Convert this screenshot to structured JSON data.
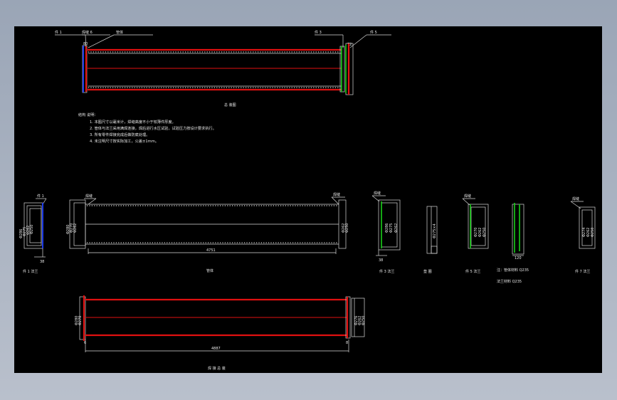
{
  "notes": {
    "title": "结构 说明：",
    "lines": [
      "1. 本图尺寸以毫米计，焊缝高度不小于较薄件厚度。",
      "2. 管体与法兰采用满焊连接，焊后进行水压试验，试验压力按设计要求执行。",
      "3. 所有零件焊接完成后做防腐处理。",
      "4. 未注明尺寸按实际加工，公差±1mm。"
    ]
  },
  "views": {
    "top_caption": "总 装图",
    "left_dims": [
      "Φ286",
      "Φ275",
      "Φ262",
      "Φ250"
    ],
    "left_bottom": "38",
    "left_caption": "件 1 法兰",
    "tube_dims": [
      "Φ280",
      "Φ270",
      "Φ262"
    ],
    "tube_right_dims": [
      "Φ262",
      "Φ250"
    ],
    "tube_length": "4751",
    "tube_caption": "管体",
    "part3_dims": [
      "Φ286",
      "Φ275",
      "Φ262"
    ],
    "part3_bottom": "38",
    "part3_caption": "件 3 法兰",
    "part4_dim": "Φ275×4",
    "part4_caption": "垫 圈",
    "part5_dims": [
      "Φ270",
      "Φ262",
      "Φ250"
    ],
    "part5_caption": "件 5 法兰",
    "part6_bottom": "120",
    "legend_lines": [
      "注：管体材料 Q235",
      "法兰材料 Q235"
    ],
    "part7_dims": [
      "Φ274",
      "Φ262",
      "Φ250"
    ],
    "part7_caption": "件 7 法兰",
    "bottom_dims": [
      "Φ280",
      "Φ270"
    ],
    "bottom_right_dims": [
      "Φ276",
      "Φ262",
      "Φ250"
    ],
    "bottom_length": "4887",
    "bottom_left_mark": "6",
    "bottom_right_mark": "8",
    "bottom_caption": "焊 接 总 装"
  },
  "callouts": {
    "top_left_a": "件 1",
    "top_left_b": "焊缝 6",
    "top_left_c": "管体",
    "top_left_num": "80",
    "top_right_a": "件 3",
    "top_right_b": "件 5",
    "top_right_num": "72",
    "mid_left": "件 1",
    "mid_tube_left": "焊缝",
    "mid_tube_right": "焊缝",
    "mid_p3": "焊缝",
    "mid_p5": "焊缝",
    "mid_p7": "焊缝"
  },
  "colors": {
    "background": "#000000",
    "line": "#d8d8d8",
    "red": "#e01010",
    "green": "#19d019",
    "blue": "#2040ff"
  }
}
